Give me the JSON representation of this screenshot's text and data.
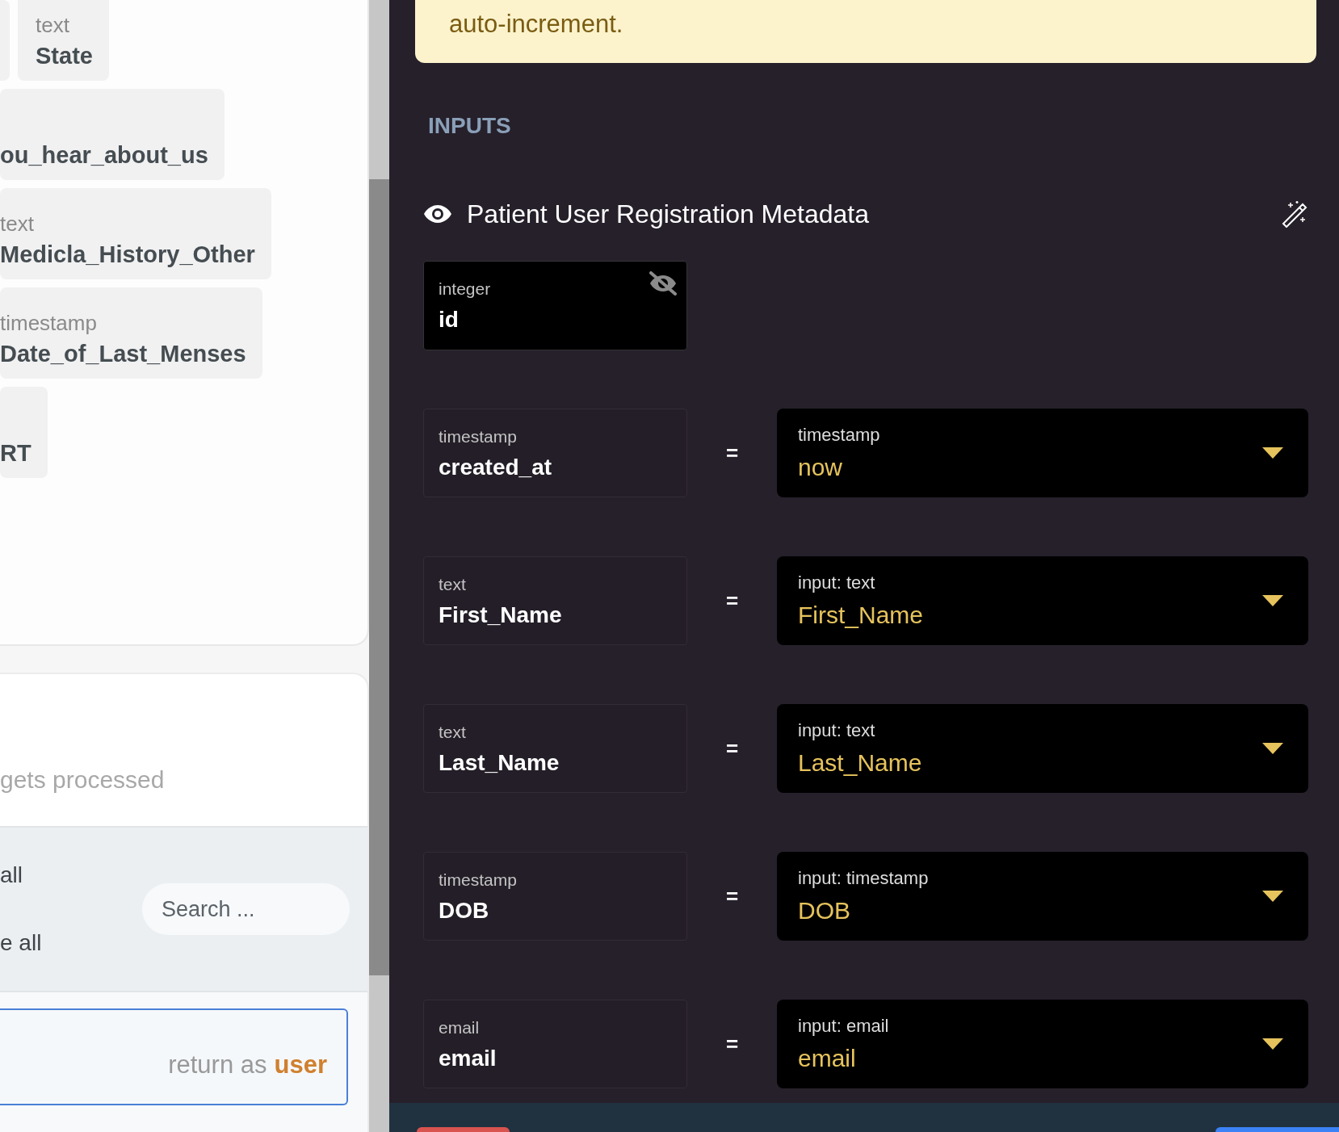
{
  "left_panel": {
    "field_rows": [
      [
        {
          "type": "text",
          "name": "State"
        }
      ],
      [
        {
          "name": "ou_hear_about_us"
        }
      ],
      [
        {
          "type": "text",
          "name": "Medicla_History_Other"
        }
      ],
      [
        {
          "type": "timestamp",
          "name": "Date_of_Last_Menses"
        }
      ],
      [
        {
          "name": "RT"
        }
      ]
    ],
    "description_placeholder": "gets processed",
    "select_options": [
      "all",
      "e all"
    ],
    "search": {
      "placeholder": "Search ..."
    },
    "return": {
      "label": "return as",
      "variable": "user"
    }
  },
  "right_panel": {
    "notice": "auto-increment.",
    "section_title": "INPUTS",
    "table": {
      "title": "Patient User Registration Metadata",
      "primary": {
        "type": "integer",
        "name": "id"
      },
      "mappings": [
        {
          "type": "timestamp",
          "name": "created_at",
          "operator": "=",
          "source_type": "timestamp",
          "source": "now"
        },
        {
          "type": "text",
          "name": "First_Name",
          "operator": "=",
          "source_type": "input: text",
          "source": "First_Name"
        },
        {
          "type": "text",
          "name": "Last_Name",
          "operator": "=",
          "source_type": "input: text",
          "source": "Last_Name"
        },
        {
          "type": "timestamp",
          "name": "DOB",
          "operator": "=",
          "source_type": "input: timestamp",
          "source": "DOB"
        },
        {
          "type": "email",
          "name": "email",
          "operator": "=",
          "source_type": "input: email",
          "source": "email"
        }
      ]
    }
  }
}
